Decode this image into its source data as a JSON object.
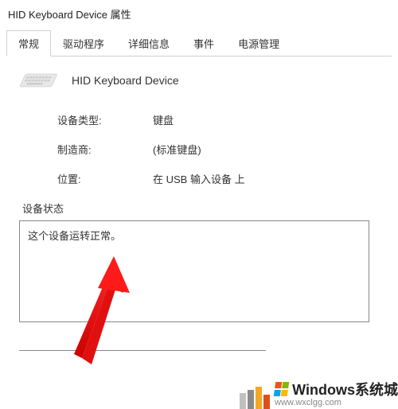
{
  "window": {
    "title": "HID Keyboard Device 属性"
  },
  "tabs": [
    {
      "label": "常规",
      "active": true
    },
    {
      "label": "驱动程序",
      "active": false
    },
    {
      "label": "详细信息",
      "active": false
    },
    {
      "label": "事件",
      "active": false
    },
    {
      "label": "电源管理",
      "active": false
    }
  ],
  "device": {
    "name": "HID Keyboard Device",
    "type_label": "设备类型:",
    "type_value": "键盘",
    "manufacturer_label": "制造商:",
    "manufacturer_value": "(标准键盘)",
    "location_label": "位置:",
    "location_value": "在 USB 输入设备 上"
  },
  "status": {
    "label": "设备状态",
    "text": "这个设备运转正常。"
  },
  "watermark": {
    "brand": "Windows系统城",
    "url": "www.wxclgg.com"
  }
}
